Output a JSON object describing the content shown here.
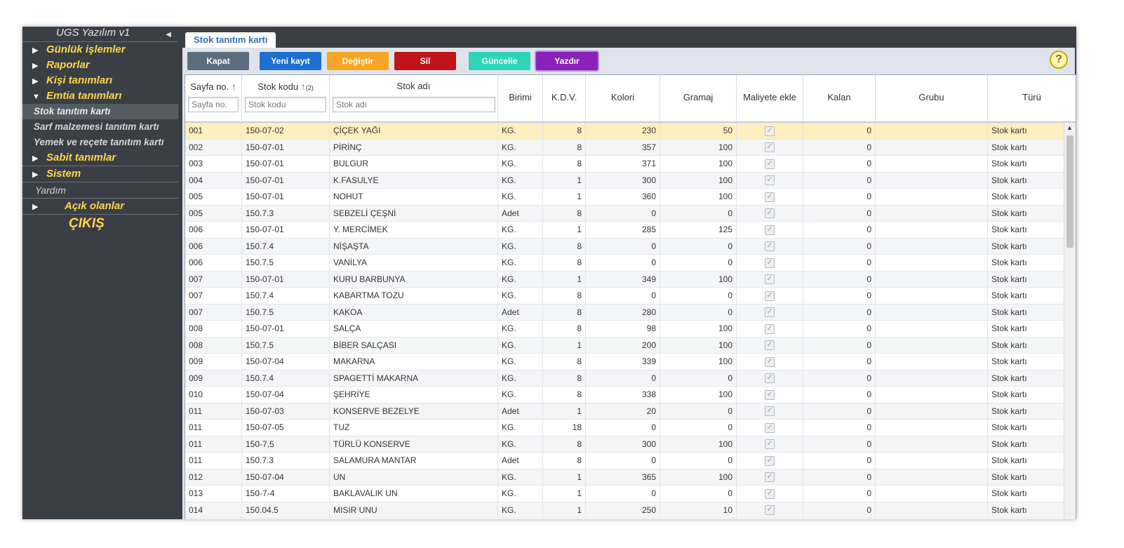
{
  "sidebar": {
    "title": "UGS Yazılım v1",
    "items": [
      {
        "label": "Günlük işlemler"
      },
      {
        "label": "Raporlar"
      },
      {
        "label": "Kişi tanımları"
      },
      {
        "label": "Emtia tanımları"
      }
    ],
    "sub_items": [
      {
        "label": "Stok tanıtım kartı"
      },
      {
        "label": "Sarf malzemesi tanıtım kartı"
      },
      {
        "label": "Yemek ve reçete tanıtım kartı"
      }
    ],
    "items2": [
      {
        "label": "Sabit tanımlar"
      },
      {
        "label": "Sistem"
      }
    ],
    "help": "Yardım",
    "open": "Açık olanlar",
    "exit": "ÇIKIŞ"
  },
  "tab": {
    "label": "Stok tanıtım kartı"
  },
  "toolbar": {
    "kapat": "Kapat",
    "yeni": "Yeni kayıt",
    "degistir": "Değiştir",
    "sil": "Sil",
    "guncelle": "Güncelle",
    "yazdir": "Yazdır",
    "help_icon": "?",
    "colors": {
      "kapat": "#5a6e7d",
      "yeni": "#1e6fd0",
      "degistir": "#f5a623",
      "sil": "#c0141a",
      "guncelle": "#2ed4b8",
      "yazdir": "#8a21b8"
    }
  },
  "columns": {
    "sayfa": "Sayfa no.",
    "sayfa_ph": "Sayfa no.",
    "kod": "Stok kodu",
    "kod_ph": "Stok kodu",
    "kod_sort": "(2)",
    "adi": "Stok adı",
    "adi_ph": "Stok adı",
    "birim": "Birimi",
    "kdv": "K.D.V.",
    "kolori": "Kolori",
    "gramaj": "Gramaj",
    "maliyet": "Maliyete ekle",
    "kalan": "Kalan",
    "grubu": "Grubu",
    "turu": "Türü"
  },
  "rows": [
    {
      "sayfa": "001",
      "kod": "150-07-02",
      "adi": "ÇİÇEK YAĞI",
      "birim": "KG.",
      "kdv": "8",
      "kolori": "230",
      "gramaj": "50",
      "kalan": "0",
      "grubu": "",
      "turu": "Stok kartı"
    },
    {
      "sayfa": "002",
      "kod": "150-07-01",
      "adi": "PİRİNÇ",
      "birim": "KG.",
      "kdv": "8",
      "kolori": "357",
      "gramaj": "100",
      "kalan": "0",
      "grubu": "",
      "turu": "Stok kartı"
    },
    {
      "sayfa": "003",
      "kod": "150-07-01",
      "adi": "BULGUR",
      "birim": "KG.",
      "kdv": "8",
      "kolori": "371",
      "gramaj": "100",
      "kalan": "0",
      "grubu": "",
      "turu": "Stok kartı"
    },
    {
      "sayfa": "004",
      "kod": "150-07-01",
      "adi": "K.FASULYE",
      "birim": "KG.",
      "kdv": "1",
      "kolori": "300",
      "gramaj": "100",
      "kalan": "0",
      "grubu": "",
      "turu": "Stok kartı"
    },
    {
      "sayfa": "005",
      "kod": "150-07-01",
      "adi": "NOHUT",
      "birim": "KG.",
      "kdv": "1",
      "kolori": "360",
      "gramaj": "100",
      "kalan": "0",
      "grubu": "",
      "turu": "Stok kartı"
    },
    {
      "sayfa": "005",
      "kod": "150.7.3",
      "adi": "SEBZELİ ÇEŞNİ",
      "birim": "Adet",
      "kdv": "8",
      "kolori": "0",
      "gramaj": "0",
      "kalan": "0",
      "grubu": "",
      "turu": "Stok kartı"
    },
    {
      "sayfa": "006",
      "kod": "150-07-01",
      "adi": "Y. MERCİMEK",
      "birim": "KG.",
      "kdv": "1",
      "kolori": "285",
      "gramaj": "125",
      "kalan": "0",
      "grubu": "",
      "turu": "Stok kartı"
    },
    {
      "sayfa": "006",
      "kod": "150.7.4",
      "adi": "NİŞAŞTA",
      "birim": "KG.",
      "kdv": "8",
      "kolori": "0",
      "gramaj": "0",
      "kalan": "0",
      "grubu": "",
      "turu": "Stok kartı"
    },
    {
      "sayfa": "006",
      "kod": "150.7.5",
      "adi": "VANİLYA",
      "birim": "KG.",
      "kdv": "8",
      "kolori": "0",
      "gramaj": "0",
      "kalan": "0",
      "grubu": "",
      "turu": "Stok kartı"
    },
    {
      "sayfa": "007",
      "kod": "150-07-01",
      "adi": "KURU BARBUNYA",
      "birim": "KG.",
      "kdv": "1",
      "kolori": "349",
      "gramaj": "100",
      "kalan": "0",
      "grubu": "",
      "turu": "Stok kartı"
    },
    {
      "sayfa": "007",
      "kod": "150.7.4",
      "adi": "KABARTMA TOZU",
      "birim": "KG.",
      "kdv": "8",
      "kolori": "0",
      "gramaj": "0",
      "kalan": "0",
      "grubu": "",
      "turu": "Stok kartı"
    },
    {
      "sayfa": "007",
      "kod": "150.7.5",
      "adi": "KAKOA",
      "birim": "Adet",
      "kdv": "8",
      "kolori": "280",
      "gramaj": "0",
      "kalan": "0",
      "grubu": "",
      "turu": "Stok kartı"
    },
    {
      "sayfa": "008",
      "kod": "150-07-01",
      "adi": "SALÇA",
      "birim": "KG.",
      "kdv": "8",
      "kolori": "98",
      "gramaj": "100",
      "kalan": "0",
      "grubu": "",
      "turu": "Stok kartı"
    },
    {
      "sayfa": "008",
      "kod": "150.7.5",
      "adi": "BİBER SALÇASI",
      "birim": "KG.",
      "kdv": "1",
      "kolori": "200",
      "gramaj": "100",
      "kalan": "0",
      "grubu": "",
      "turu": "Stok kartı"
    },
    {
      "sayfa": "009",
      "kod": "150-07-04",
      "adi": "MAKARNA",
      "birim": "KG.",
      "kdv": "8",
      "kolori": "339",
      "gramaj": "100",
      "kalan": "0",
      "grubu": "",
      "turu": "Stok kartı"
    },
    {
      "sayfa": "009",
      "kod": "150.7.4",
      "adi": "SPAGETTİ MAKARNA",
      "birim": "KG.",
      "kdv": "8",
      "kolori": "0",
      "gramaj": "0",
      "kalan": "0",
      "grubu": "",
      "turu": "Stok kartı"
    },
    {
      "sayfa": "010",
      "kod": "150-07-04",
      "adi": "ŞEHRİYE",
      "birim": "KG.",
      "kdv": "8",
      "kolori": "338",
      "gramaj": "100",
      "kalan": "0",
      "grubu": "",
      "turu": "Stok kartı"
    },
    {
      "sayfa": "011",
      "kod": "150-07-03",
      "adi": "KONSERVE BEZELYE",
      "birim": "Adet",
      "kdv": "1",
      "kolori": "20",
      "gramaj": "0",
      "kalan": "0",
      "grubu": "",
      "turu": "Stok kartı"
    },
    {
      "sayfa": "011",
      "kod": "150-07-05",
      "adi": "TUZ",
      "birim": "KG.",
      "kdv": "18",
      "kolori": "0",
      "gramaj": "0",
      "kalan": "0",
      "grubu": "",
      "turu": "Stok kartı"
    },
    {
      "sayfa": "011",
      "kod": "150-7,5",
      "adi": "TÜRLÜ KONSERVE",
      "birim": "KG.",
      "kdv": "8",
      "kolori": "300",
      "gramaj": "100",
      "kalan": "0",
      "grubu": "",
      "turu": "Stok kartı"
    },
    {
      "sayfa": "011",
      "kod": "150.7.3",
      "adi": "SALAMURA MANTAR",
      "birim": "Adet",
      "kdv": "8",
      "kolori": "0",
      "gramaj": "0",
      "kalan": "0",
      "grubu": "",
      "turu": "Stok kartı"
    },
    {
      "sayfa": "012",
      "kod": "150-07-04",
      "adi": "UN",
      "birim": "KG.",
      "kdv": "1",
      "kolori": "365",
      "gramaj": "100",
      "kalan": "0",
      "grubu": "",
      "turu": "Stok kartı"
    },
    {
      "sayfa": "013",
      "kod": "150-7-4",
      "adi": "BAKLAVALIK UN",
      "birim": "KG.",
      "kdv": "1",
      "kolori": "0",
      "gramaj": "0",
      "kalan": "0",
      "grubu": "",
      "turu": "Stok kartı"
    },
    {
      "sayfa": "014",
      "kod": "150.04.5",
      "adi": "MISIR UNU",
      "birim": "KG.",
      "kdv": "1",
      "kolori": "250",
      "gramaj": "10",
      "kalan": "0",
      "grubu": "",
      "turu": "Stok kartı"
    }
  ]
}
